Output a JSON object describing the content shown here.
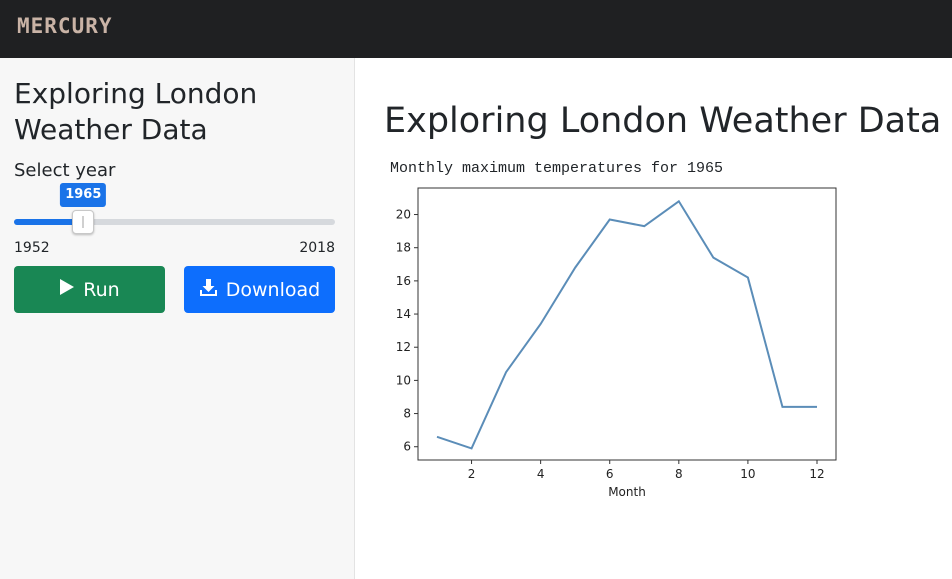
{
  "app": {
    "brand": "MERCURY"
  },
  "sidebar": {
    "title": "Exploring London Weather Data",
    "slider": {
      "label": "Select year",
      "min": 1952,
      "max": 2018,
      "value": 1965,
      "min_label": "1952",
      "max_label": "2018",
      "value_label": "1965"
    },
    "run_label": "Run",
    "download_label": "Download"
  },
  "main": {
    "title": "Exploring London Weather Data",
    "caption": "Monthly maximum temperatures for 1965"
  },
  "chart_data": {
    "type": "line",
    "title": "",
    "xlabel": "Month",
    "ylabel": "",
    "x": [
      1,
      2,
      3,
      4,
      5,
      6,
      7,
      8,
      9,
      10,
      11,
      12
    ],
    "series": [
      {
        "values": [
          6.6,
          5.9,
          10.5,
          13.4,
          16.8,
          19.7,
          19.3,
          20.8,
          17.4,
          16.2,
          8.4,
          8.4
        ]
      }
    ],
    "xlim": [
      0.45,
      12.55
    ],
    "ylim": [
      5.2,
      21.6
    ],
    "xticks": [
      2,
      4,
      6,
      8,
      10,
      12
    ],
    "yticks": [
      6,
      8,
      10,
      12,
      14,
      16,
      18,
      20
    ],
    "color": "#5b8db8",
    "grid": false
  }
}
